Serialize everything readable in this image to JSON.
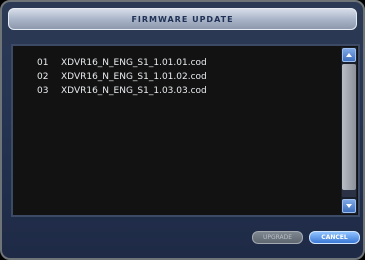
{
  "dialog": {
    "title": "FIRMWARE UPDATE",
    "files": [
      {
        "num": "01",
        "name": "XDVR16_N_ENG_S1_1.01.01.cod"
      },
      {
        "num": "02",
        "name": "XDVR16_N_ENG_S1_1.01.02.cod"
      },
      {
        "num": "03",
        "name": "XDVR16_N_ENG_S1_1.03.03.cod"
      }
    ],
    "buttons": {
      "upgrade_label": "UPGRADE",
      "cancel_label": "CANCEL"
    }
  },
  "colors": {
    "dialog_bg": "#263553",
    "list_bg": "#121212",
    "title_text": "#203255",
    "accent_blue": "#3a78d6"
  }
}
